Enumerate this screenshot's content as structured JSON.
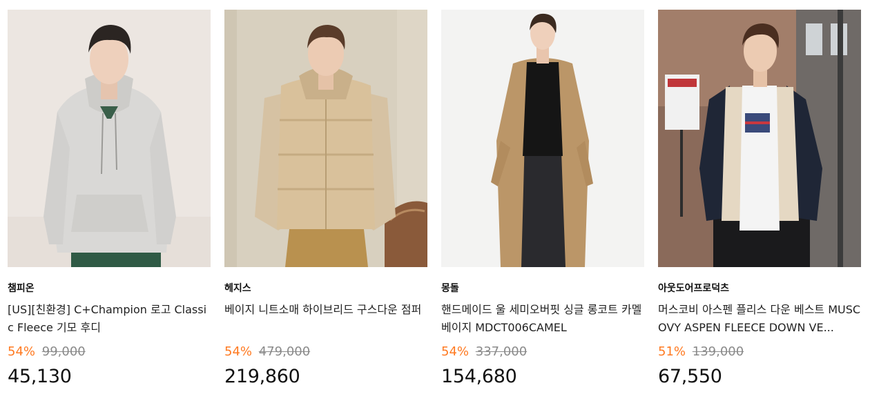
{
  "products": [
    {
      "brand": "챔피온",
      "name": "[US][친환경] C+Champion 로고 Classic Fleece 기모 후디",
      "discount_rate": "54%",
      "original_price": "99,000",
      "sale_price": "45,130",
      "image_icon": "product-photo-grey-hoodie"
    },
    {
      "brand": "헤지스",
      "name": "베이지 니트소매 하이브리드 구스다운 점퍼",
      "discount_rate": "54%",
      "original_price": "479,000",
      "sale_price": "219,860",
      "image_icon": "product-photo-beige-down-jacket"
    },
    {
      "brand": "몽돌",
      "name": "핸드메이드 울 세미오버핏 싱글 롱코트 카멜베이지 MDCT006CAMEL",
      "discount_rate": "54%",
      "original_price": "337,000",
      "sale_price": "154,680",
      "image_icon": "product-photo-camel-long-coat"
    },
    {
      "brand": "아웃도어프로덕츠",
      "name": "머스코비 아스펜 플리스 다운 베스트 MUSCOVY ASPEN FLEECE DOWN VE...",
      "discount_rate": "51%",
      "original_price": "139,000",
      "sale_price": "67,550",
      "image_icon": "product-photo-fleece-down-vest"
    }
  ],
  "colors": {
    "discount": "#ff7a21",
    "original_price": "#8a8a8a",
    "text": "#111111"
  }
}
